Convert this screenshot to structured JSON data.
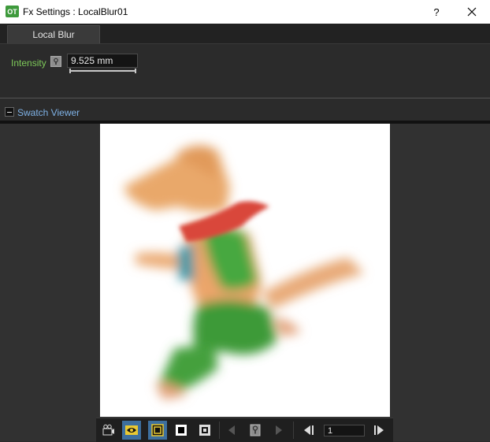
{
  "window": {
    "icon_text": "OT",
    "title": "Fx Settings : LocalBlur01",
    "help_label": "?"
  },
  "tabs": [
    {
      "label": "Local Blur",
      "active": true
    }
  ],
  "params": {
    "intensity": {
      "label": "Intensity",
      "value": "9.525 mm",
      "slider_fraction": 0.5
    }
  },
  "swatch": {
    "label": "Swatch Viewer"
  },
  "toolbar": {
    "frame_value": "1"
  },
  "colors": {
    "param_label": "#7ec95a",
    "swatch_label": "#7fb2e6",
    "active_button": "#3d6f9e",
    "background": "#2b2b2b"
  }
}
